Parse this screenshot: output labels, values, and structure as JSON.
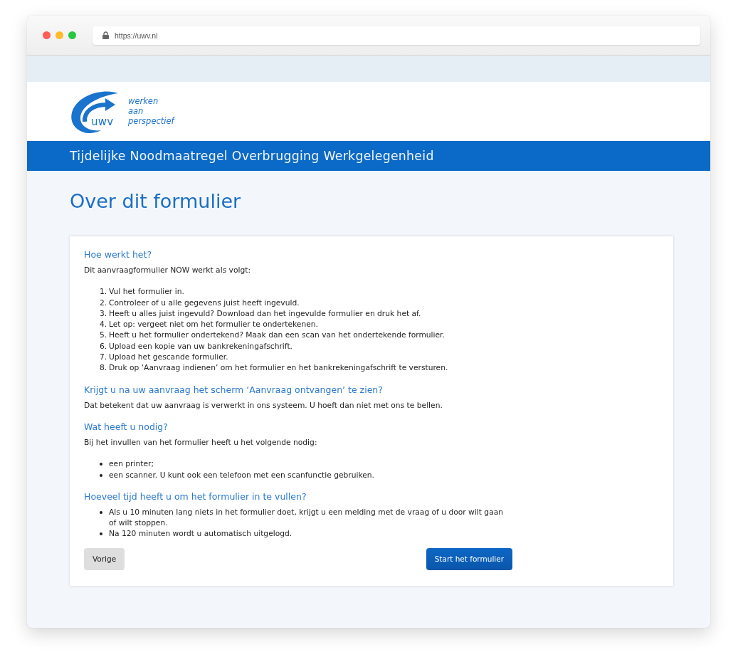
{
  "browser": {
    "url": "https://uwv.nl"
  },
  "header": {
    "logo_wordmark": "uwv",
    "tagline": "werken aan perspectief"
  },
  "banner": {
    "title": "Tijdelijke Noodmaatregel Overbrugging Werkgelegenheid"
  },
  "page": {
    "title": "Over dit formulier"
  },
  "sections": [
    {
      "kind": "numbered",
      "heading": "Hoe werkt het?",
      "intro": "Dit aanvraagformulier NOW werkt als volgt:",
      "items": [
        {
          "number": "1.",
          "text": "Vul het formulier in."
        },
        {
          "number": "2.",
          "text": "Controleer of u alle gegevens juist heeft ingevuld."
        },
        {
          "number": "3.",
          "text": "Heeft u alles juist ingevuld? Download dan het ingevulde formulier en druk het af."
        },
        {
          "number": "4.",
          "text": "Let op: vergeet niet om het formulier te ondertekenen."
        },
        {
          "number": "5.",
          "text": "Heeft u het formulier ondertekend? Maak dan een scan van het ondertekende formulier."
        },
        {
          "number": "6.",
          "text": "Upload een kopie van uw bankrekeningafschrift."
        },
        {
          "number": "7.",
          "text": "Upload het gescande formulier."
        },
        {
          "number": "8.",
          "text": "Druk op ‘Aanvraag indienen’ om het formulier en het bankrekeningafschrift te versturen."
        }
      ]
    },
    {
      "heading": "Krijgt u na uw aanvraag het scherm ‘Aanvraag ontvangen’ te zien?",
      "intro": "Dat betekent dat uw aanvraag is verwerkt in ons systeem. U hoeft dan niet met ons te bellen."
    },
    {
      "kind": "bulleted",
      "heading": "Wat heeft u nodig?",
      "intro": "Bij het invullen van het formulier heeft u het volgende nodig:",
      "items": [
        {
          "text": "een printer;"
        },
        {
          "text": "een scanner. U kunt ook een telefoon met een scanfunctie gebruiken."
        }
      ]
    },
    {
      "kind": "bulleted",
      "heading": "Hoeveel tijd heeft u om het formulier in te vullen?",
      "items": [
        {
          "text": "Als u 10 minuten lang niets in het formulier doet, krijgt u een melding met de vraag of u door wilt gaan of wilt stoppen."
        },
        {
          "text": "Na 120 minuten wordt u automatisch uitgelogd."
        }
      ]
    }
  ],
  "buttons": [
    {
      "kind": "secondary",
      "label": "Vorige"
    },
    {
      "kind": "primary",
      "label": "Start het formulier"
    }
  ]
}
